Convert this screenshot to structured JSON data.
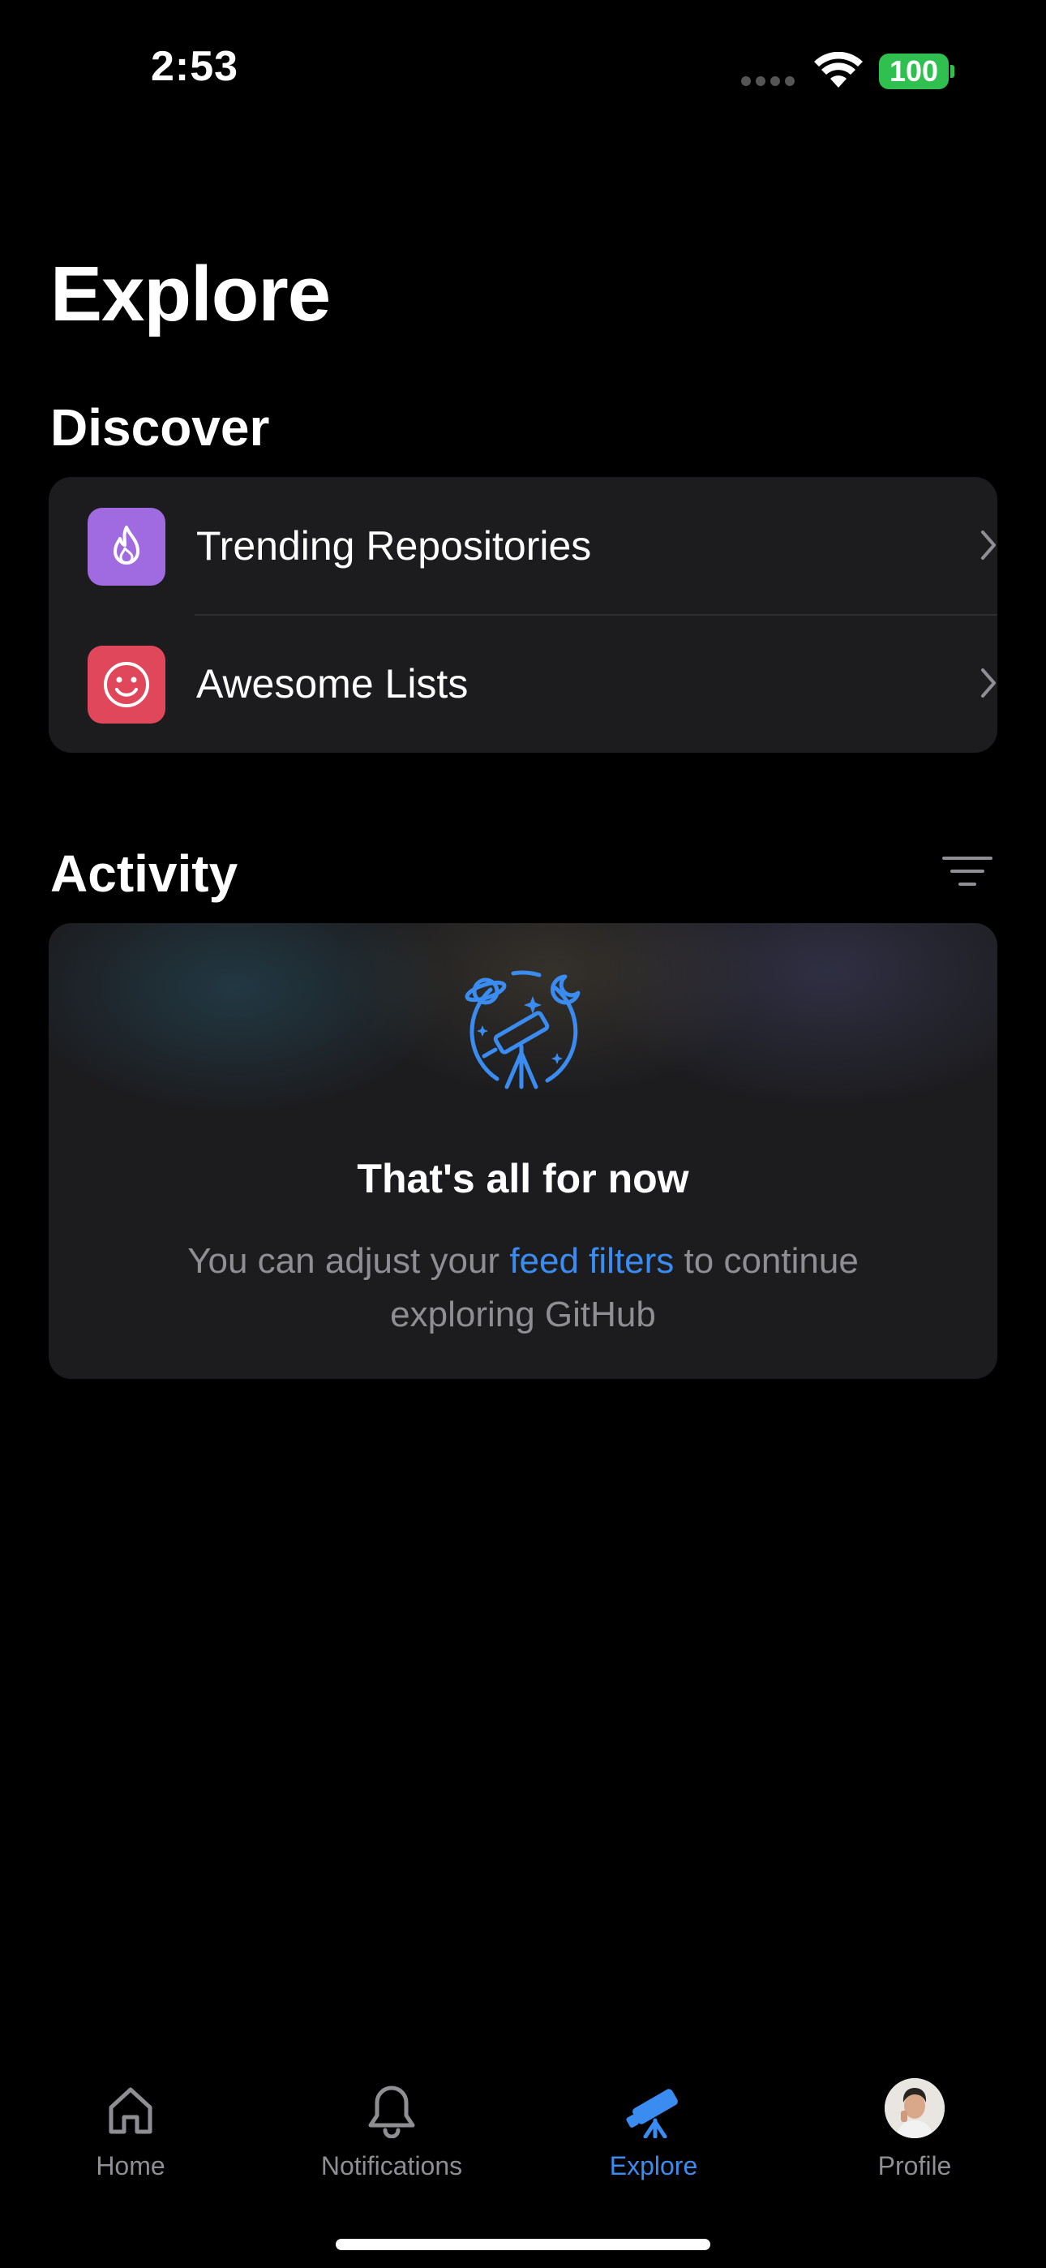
{
  "status_bar": {
    "time": "2:53",
    "battery": "100"
  },
  "page": {
    "title": "Explore"
  },
  "discover": {
    "title": "Discover",
    "items": [
      {
        "label": "Trending Repositories",
        "icon": "flame-icon",
        "color": "#a06ae0"
      },
      {
        "label": "Awesome Lists",
        "icon": "smiley-icon",
        "color": "#e0475a"
      }
    ]
  },
  "activity": {
    "title": "Activity",
    "empty_title": "That's all for now",
    "empty_text_before": "You can adjust your ",
    "empty_link": "feed filters",
    "empty_text_after": " to continue exploring GitHub"
  },
  "tabs": [
    {
      "label": "Home",
      "icon": "home-icon",
      "active": false
    },
    {
      "label": "Notifications",
      "icon": "bell-icon",
      "active": false
    },
    {
      "label": "Explore",
      "icon": "telescope-icon",
      "active": true
    },
    {
      "label": "Profile",
      "icon": "avatar",
      "active": false
    }
  ],
  "colors": {
    "accent": "#3a8cf0",
    "background": "#000000",
    "card": "#1c1c1f",
    "secondary_text": "#8e8e93",
    "battery": "#30c04f"
  }
}
